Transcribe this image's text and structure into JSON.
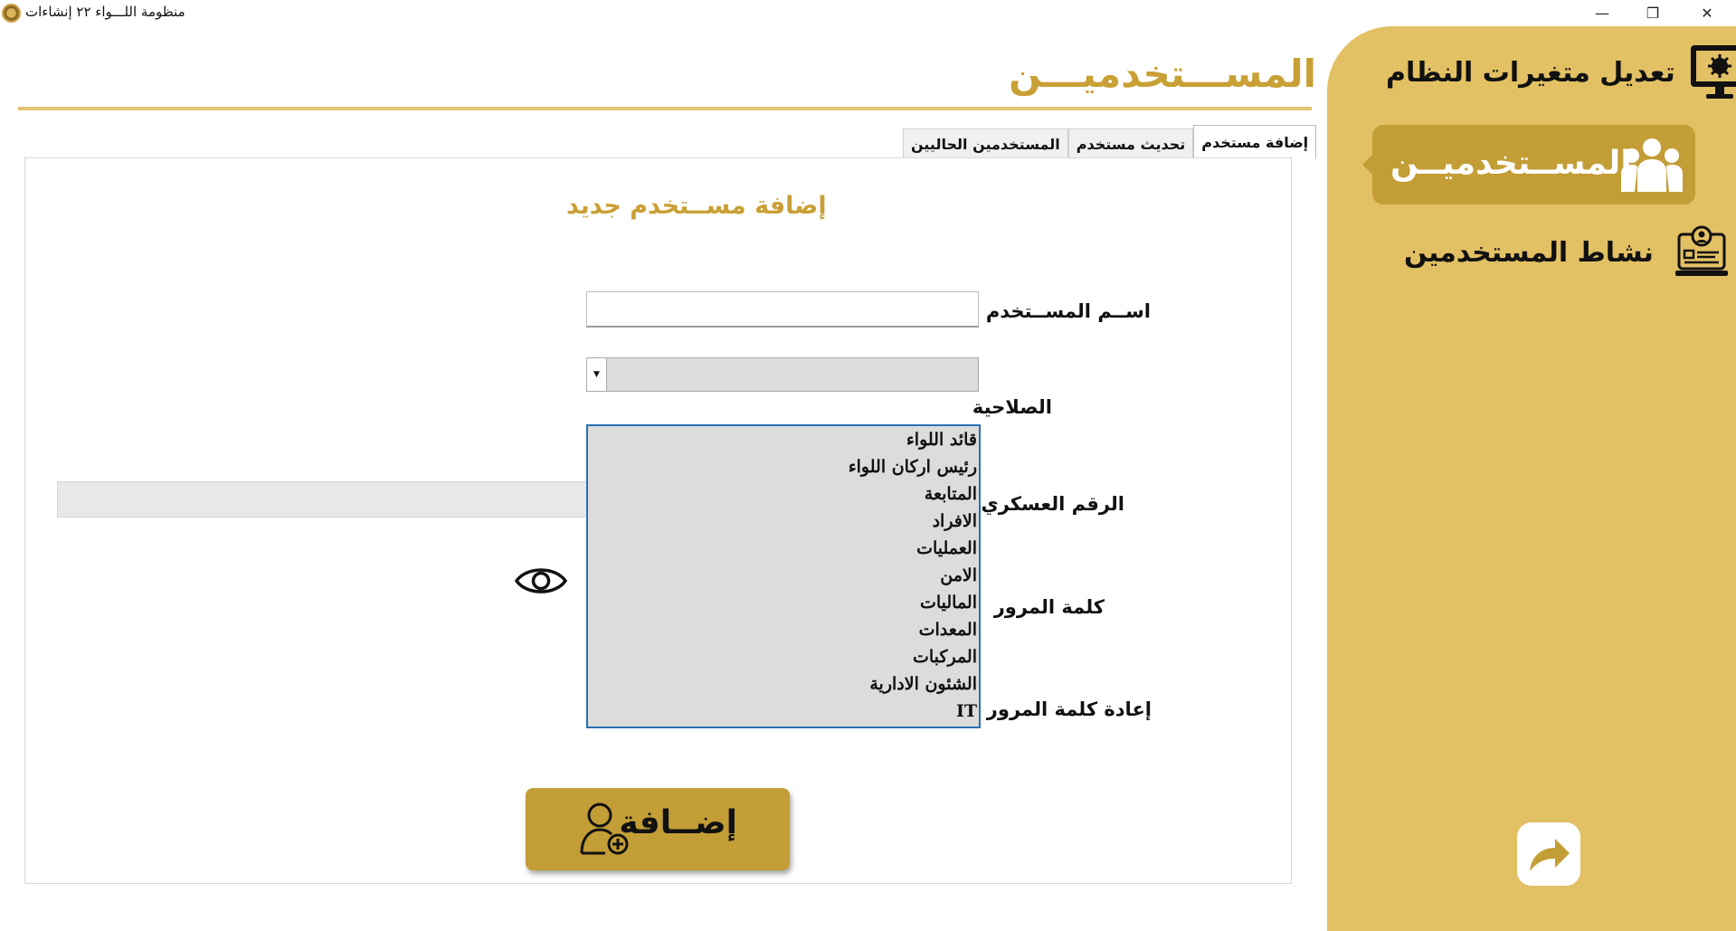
{
  "window": {
    "title": "منظومة اللـــواء ٢٢ إنشاءات",
    "minimize": "—",
    "restore": "❐",
    "close": "✕"
  },
  "page": {
    "title": "المســـتخدميـــن"
  },
  "tabs": [
    {
      "label": "إضافة مستخدم",
      "active": true
    },
    {
      "label": "تحديث مستخدم",
      "active": false
    },
    {
      "label": "المستخدمين الحاليين",
      "active": false
    }
  ],
  "form": {
    "title": "إضافة مســتخدم جديد",
    "username_label": "اســم المســتخدم",
    "role_label": "الصلاحية",
    "military_number_label": "الرقم العسكري",
    "password_label": "كلمة المرور",
    "confirm_password_label": "إعادة كلمة المرور",
    "add_button_label": "إضــافة"
  },
  "role_options": [
    "قائد اللواء",
    "رئيس اركان اللواء",
    "المتابعة",
    "الافراد",
    "العمليات",
    "الامن",
    "الماليات",
    "المعدات",
    "المركبات",
    "الشئون الادارية",
    "IT"
  ],
  "sidebar": {
    "items": [
      {
        "label": "تعديل متغيرات النظام",
        "icon": "monitor-settings-icon"
      },
      {
        "label": "المســتخدميــن",
        "icon": "users-group-icon",
        "active": true
      },
      {
        "label": "نشاط المستخدمين",
        "icon": "user-activity-icon"
      }
    ],
    "back_icon": "share-arrow-icon"
  },
  "colors": {
    "accent": "#c39d36",
    "sidebar_bg": "#e2c064",
    "title_gold": "#c9a035"
  }
}
